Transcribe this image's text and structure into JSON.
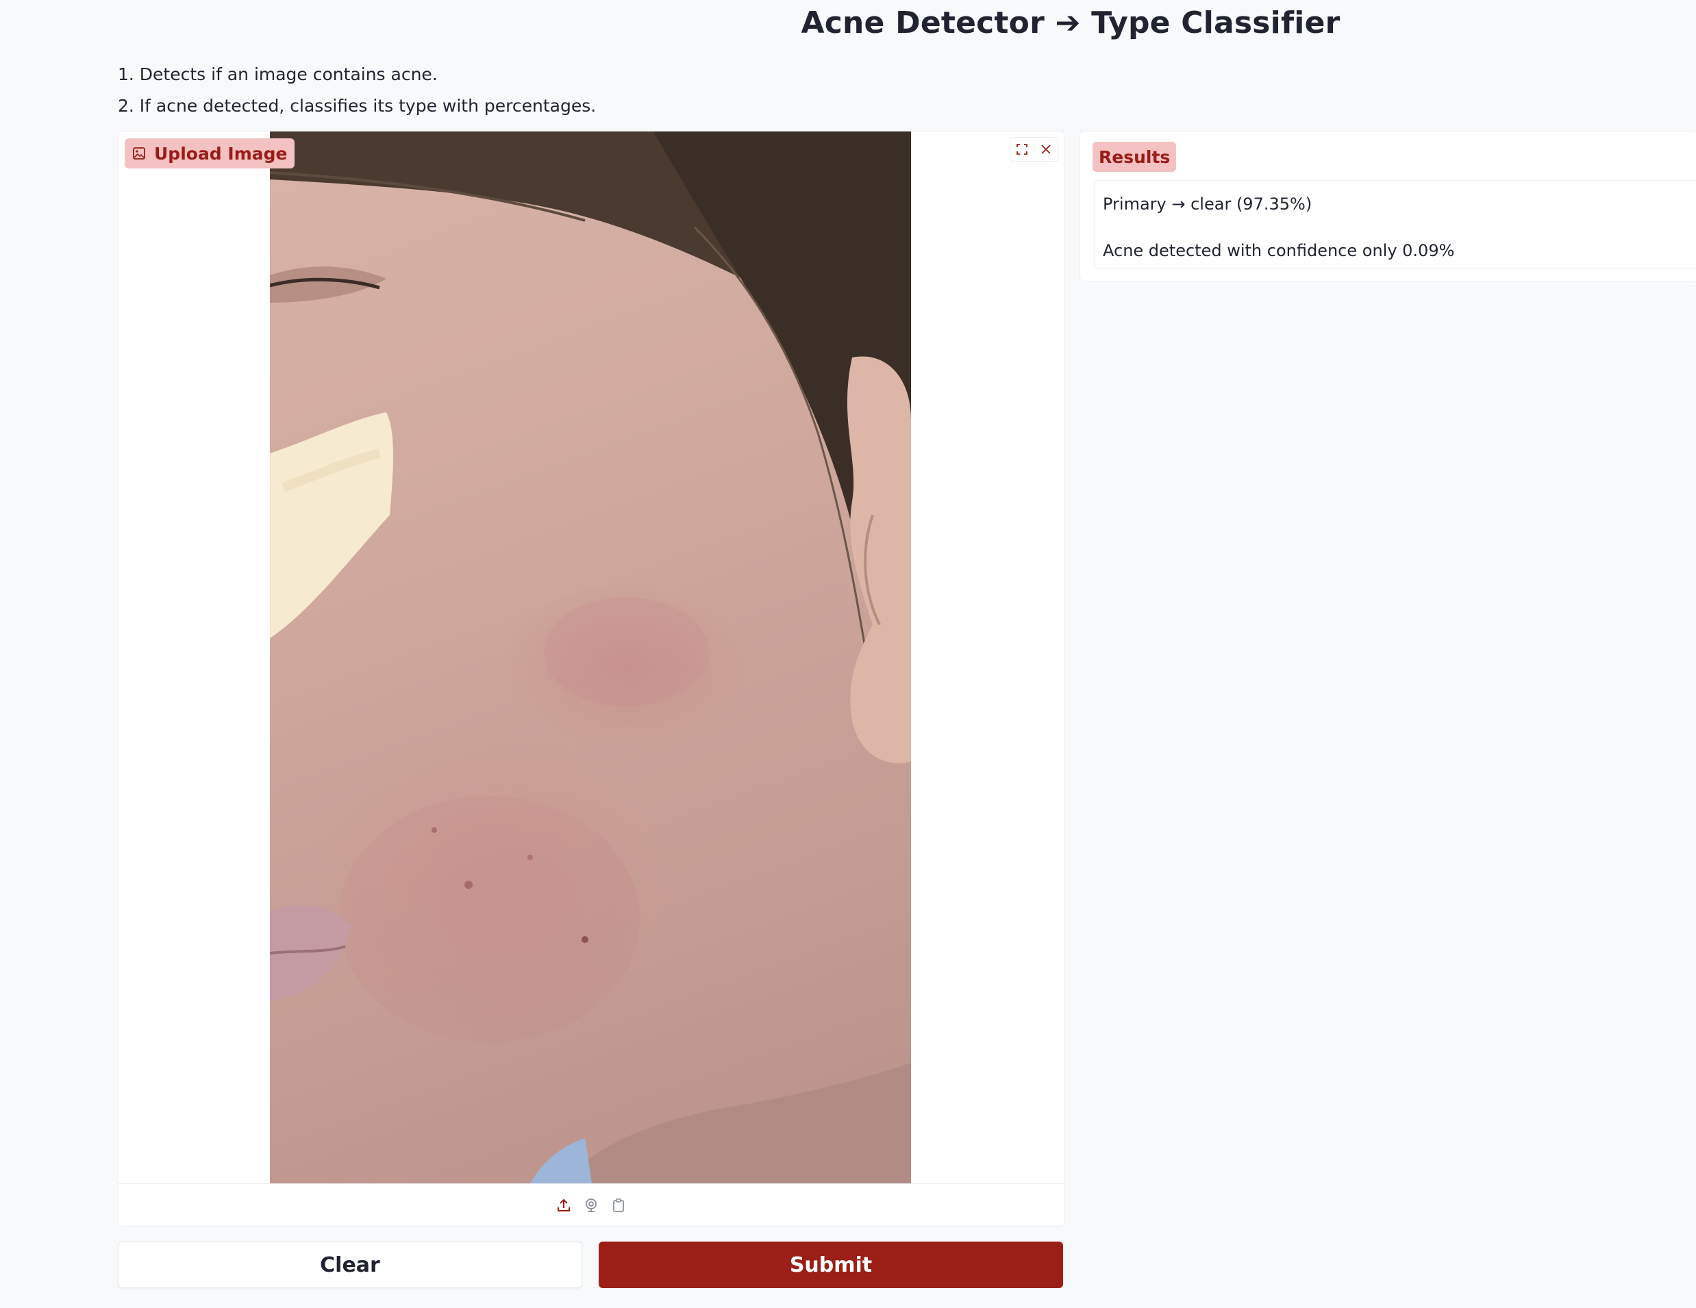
{
  "page": {
    "title": "Acne Detector ➔ Type Classifier",
    "description": [
      "1. Detects if an image contains acne.",
      "2. If acne detected, classifies its type with percentages."
    ]
  },
  "upload": {
    "label": "Upload Image",
    "label_icon": "image-icon",
    "tools": [
      "fullscreen-icon",
      "close-icon"
    ],
    "sources": [
      "upload-icon",
      "webcam-icon",
      "clipboard-icon"
    ]
  },
  "buttons": {
    "clear": "Clear",
    "submit": "Submit"
  },
  "results": {
    "label": "Results",
    "lines": [
      "Primary → clear (97.35%)",
      "Acne detected with confidence only 0.09%"
    ]
  },
  "colors": {
    "accent": "#9b1f17",
    "label_bg": "#f4c2c2",
    "background": "#f8f9fb"
  }
}
